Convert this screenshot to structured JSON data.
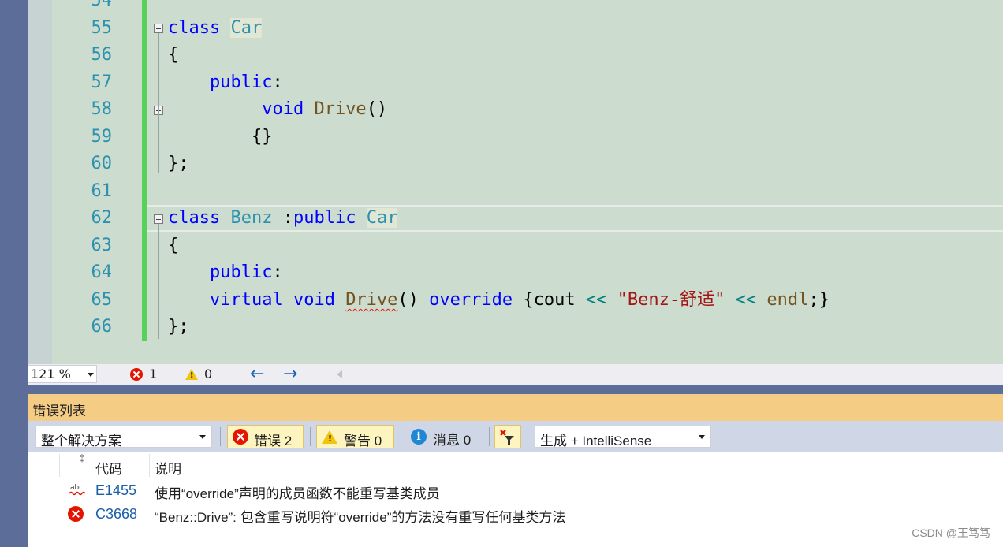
{
  "editor": {
    "line_numbers": [
      "54",
      "55",
      "56",
      "57",
      "58",
      "59",
      "60",
      "61",
      "62",
      "63",
      "64",
      "65",
      "66"
    ],
    "code": {
      "l55_kw": "class",
      "l55_ty": "Car",
      "l56": "{",
      "l57_kw": "public",
      "l57_colon": ":",
      "l58_kw": "void",
      "l58_fn": "Drive",
      "l58_paren": "()",
      "l59": "{}",
      "l60": "};",
      "l62_kw": "class",
      "l62_ty": "Benz",
      "l62_colon": " :",
      "l62_kw2": "public",
      "l62_ty2": "Car",
      "l63": "{",
      "l64_kw": "public",
      "l64_colon": ":",
      "l65_kw1": "virtual",
      "l65_kw2": "void",
      "l65_fn": "Drive",
      "l65_paren": "()",
      "l65_kw3": "override",
      "l65_brace": "{cout",
      "l65_op1": "<<",
      "l65_str": "\"Benz-舒适\"",
      "l65_op2": "<<",
      "l65_endl": "endl",
      "l65_end": ";}",
      "l66": "};"
    }
  },
  "status_bar": {
    "zoom": "121 %",
    "error_count": "1",
    "warning_count": "0",
    "back_arrow": "←",
    "forward_arrow": "→"
  },
  "error_list": {
    "title": "错误列表",
    "scope": "整个解决方案",
    "errors_btn": "错误 2",
    "warnings_btn": "警告 0",
    "messages_btn": "消息 0",
    "build_filter": "生成 + IntelliSense",
    "columns": {
      "code": "代码",
      "description": "说明"
    },
    "rows": [
      {
        "code": "E1455",
        "description": "使用“override”声明的成员函数不能重写基类成员"
      },
      {
        "code": "C3668",
        "description": "“Benz::Drive”: 包含重写说明符“override”的方法没有重写任何基类方法"
      }
    ]
  },
  "watermark": "CSDN @王笃笃",
  "colors": {
    "editor_bg": "#ccdccf",
    "keyword": "#0000ff",
    "type": "#2b91af",
    "function": "#74531f",
    "string": "#a31515",
    "error": "#e51400",
    "panel_title": "#f5cc84"
  }
}
